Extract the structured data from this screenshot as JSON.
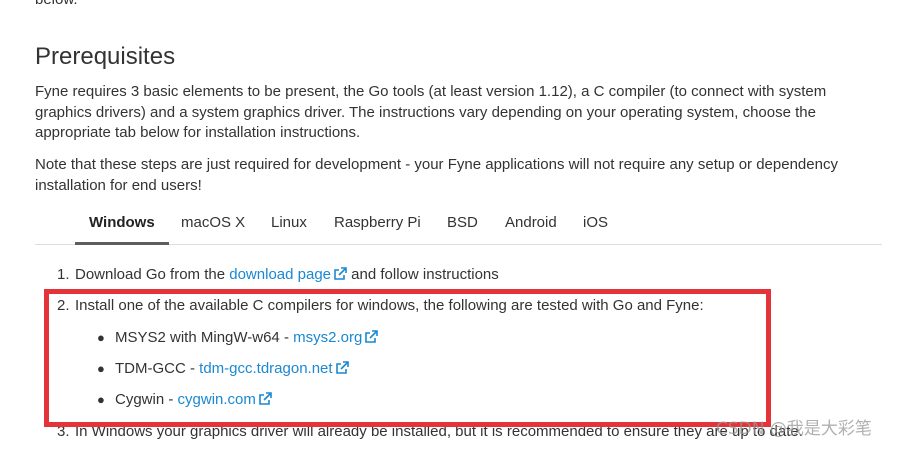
{
  "top_fragment": "below.",
  "section": {
    "title": "Prerequisites",
    "paragraph1": "Fyne requires 3 basic elements to be present, the Go tools (at least version 1.12), a C compiler (to connect with system graphics drivers) and a system graphics driver. The instructions vary depending on your operating system, choose the appropriate tab below for installation instructions.",
    "paragraph2": "Note that these steps are just required for development - your Fyne applications will not require any setup or dependency installation for end users!"
  },
  "tabs": [
    {
      "label": "Windows",
      "active": true
    },
    {
      "label": "macOS X",
      "active": false
    },
    {
      "label": "Linux",
      "active": false
    },
    {
      "label": "Raspberry Pi",
      "active": false
    },
    {
      "label": "BSD",
      "active": false
    },
    {
      "label": "Android",
      "active": false
    },
    {
      "label": "iOS",
      "active": false
    }
  ],
  "steps": {
    "step1": {
      "number": "1.",
      "text_before": "Download Go from the ",
      "link": "download page",
      "text_after": " and follow instructions"
    },
    "step2": {
      "number": "2.",
      "text": "Install one of the available C compilers for windows, the following are tested with Go and Fyne:",
      "compilers": [
        {
          "name": "MSYS2 with MingW-w64 - ",
          "link": "msys2.org"
        },
        {
          "name": "TDM-GCC - ",
          "link": "tdm-gcc.tdragon.net"
        },
        {
          "name": "Cygwin - ",
          "link": "cygwin.com"
        }
      ]
    },
    "step3": {
      "number": "3.",
      "text": "In Windows your graphics driver will already be installed, but it is recommended to ensure they are up to date."
    }
  },
  "watermark": "CSDN @我是大彩笔",
  "icons": {
    "external_link": "external-link-icon"
  },
  "colors": {
    "link": "#1a88d2",
    "highlight": "#e5333a",
    "text": "#333333"
  }
}
